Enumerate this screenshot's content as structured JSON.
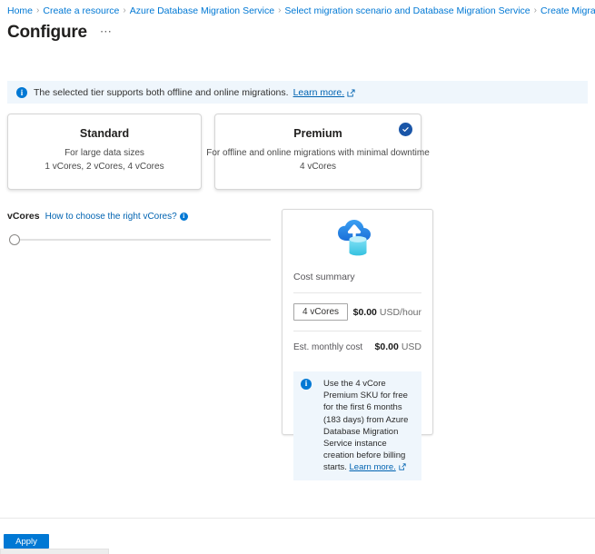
{
  "breadcrumb": {
    "separator": "›",
    "items": [
      {
        "label": "Home"
      },
      {
        "label": "Create a resource"
      },
      {
        "label": "Azure Database Migration Service"
      },
      {
        "label": "Select migration scenario and Database Migration Service"
      },
      {
        "label": "Create Migration Service"
      }
    ]
  },
  "header": {
    "title": "Configure",
    "overflow": "⋯"
  },
  "banner": {
    "icon": "info-icon",
    "text": "The selected tier supports both offline and online migrations.",
    "link_label": "Learn more.",
    "link_icon": "external-link-icon"
  },
  "tiers": [
    {
      "name": "Standard",
      "description": "For large data sizes",
      "cores": "1 vCores, 2 vCores, 4 vCores",
      "selected": false
    },
    {
      "name": "Premium",
      "description": "For offline and online migrations with minimal downtime",
      "cores": "4 vCores",
      "selected": true
    }
  ],
  "vcores": {
    "label": "vCores",
    "help_link": "How to choose the right vCores?",
    "help_icon": "info-icon",
    "slider_position_percent": 0
  },
  "cost_summary": {
    "icon": "azure-database-migration-service-icon",
    "title": "Cost summary",
    "vcore_chip": "4 vCores",
    "hourly_price": "$0.00",
    "hourly_unit": "USD/hour",
    "monthly_label": "Est. monthly cost",
    "monthly_price": "$0.00",
    "monthly_unit": "USD",
    "note": {
      "icon": "info-icon",
      "text": "Use the 4 vCore Premium SKU for free for the first 6 months (183 days) from Azure Database Migration Service instance creation before billing starts.",
      "link_label": "Learn more.",
      "link_icon": "external-link-icon"
    }
  },
  "footer": {
    "apply_label": "Apply"
  },
  "colors": {
    "accent": "#0078d4",
    "link": "#0063b1",
    "banner_bg": "#eff6fc",
    "selected_badge": "#1a56a8",
    "text": "#323130"
  }
}
